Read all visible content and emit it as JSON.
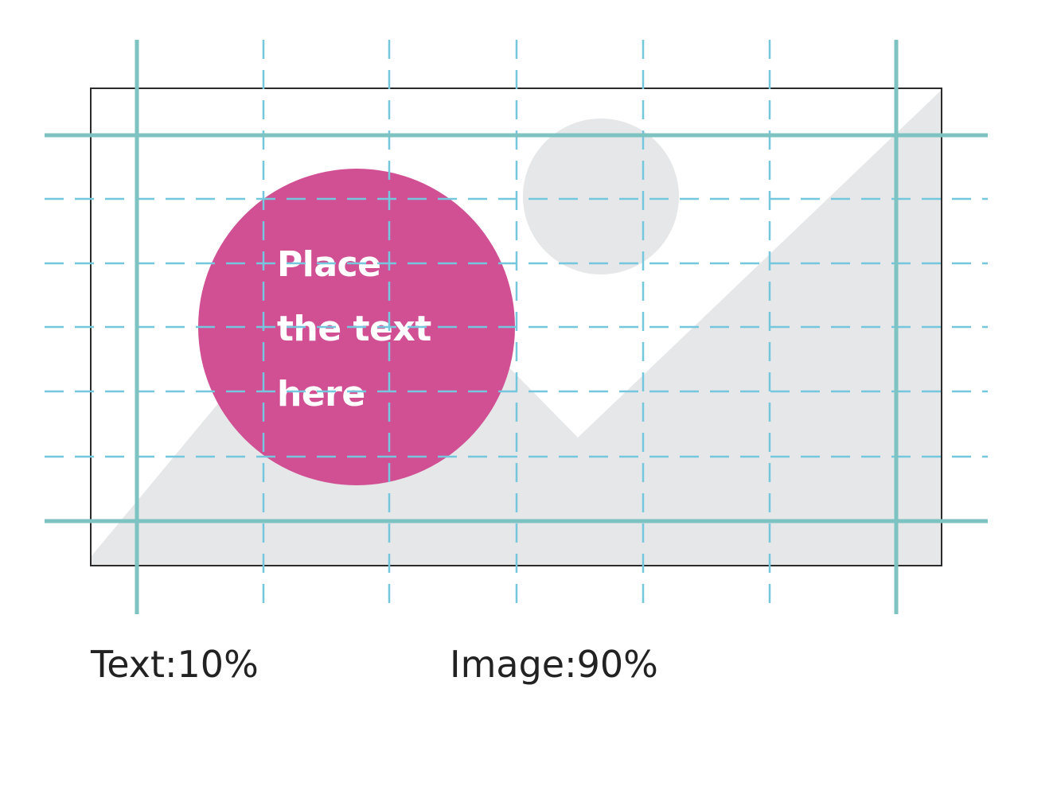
{
  "colors": {
    "grid_solid": "#7cc3c1",
    "grid_dashed": "#74c7dc",
    "badge": "#d14f93",
    "badge_text": "#ffffff",
    "image_placeholder": "#e6e7e8",
    "frame": "#2b2b2b"
  },
  "badge": {
    "lines": [
      "Place",
      "the text",
      "here"
    ]
  },
  "captions": {
    "text_ratio": "Text:10%",
    "image_ratio": "Image:90%"
  },
  "icons": [
    "image-placeholder-icon",
    "sun-circle-icon",
    "mountain-shape-icon"
  ]
}
